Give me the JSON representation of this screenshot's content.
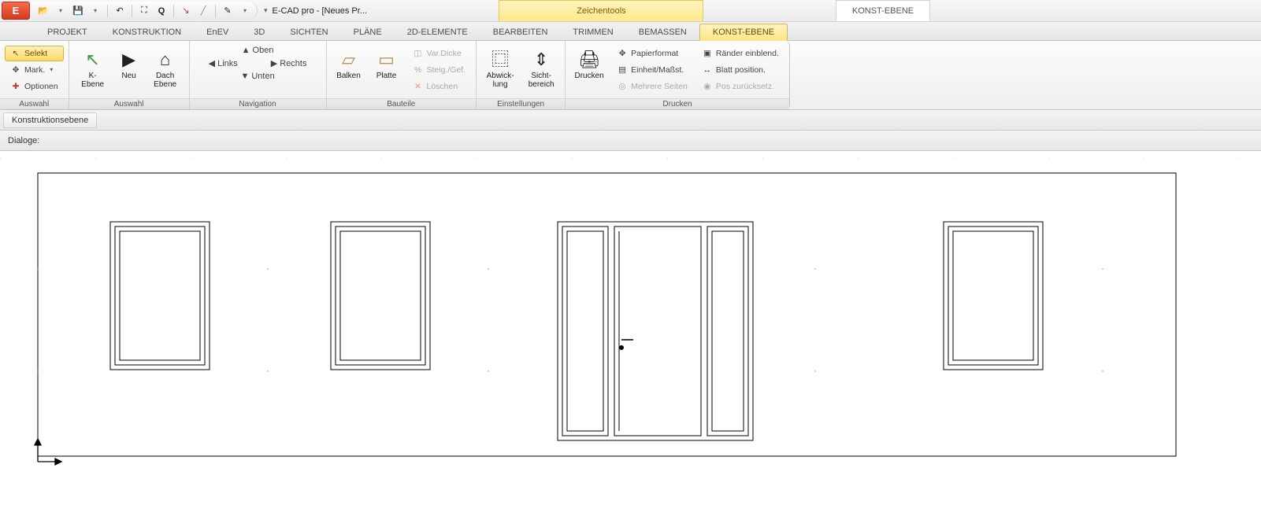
{
  "app": {
    "logo_letter": "E",
    "title": "E-CAD pro - [Neues Pr...",
    "context_tab": "Zeichentools",
    "context_tab2": "KONST-EBENE"
  },
  "qat": {
    "dropdown_glyph": "▾"
  },
  "tabs": [
    "PROJEKT",
    "KONSTRUKTION",
    "EnEV",
    "3D",
    "SICHTEN",
    "PLÄNE",
    "2D-ELEMENTE",
    "BEARBEITEN",
    "TRIMMEN",
    "BEMASSEN",
    "KONST-EBENE"
  ],
  "active_tab": "KONST-EBENE",
  "ribbon": {
    "auswahl1": {
      "label": "Auswahl",
      "selekt": "Selekt",
      "mark": "Mark.",
      "optionen": "Optionen"
    },
    "auswahl2": {
      "label": "Auswahl",
      "kebene_l1": "K-",
      "kebene_l2": "Ebene",
      "neu": "Neu",
      "dach_l1": "Dach",
      "dach_l2": "Ebene"
    },
    "navigation": {
      "label": "Navigation",
      "oben": "Oben",
      "links": "Links",
      "rechts": "Rechts",
      "unten": "Unten"
    },
    "bauteile": {
      "label": "Bauteile",
      "balken": "Balken",
      "platte": "Platte",
      "vardicke": "Var.Dicke",
      "steig": "Steig./Gef.",
      "loeschen": "Löschen"
    },
    "einstellungen": {
      "label": "Einstellungen",
      "abwick_l1": "Abwick-",
      "abwick_l2": "lung",
      "sicht_l1": "Sicht-",
      "sicht_l2": "bereich"
    },
    "drucken": {
      "label": "Drucken",
      "drucken": "Drucken",
      "papierformat": "Papierformat",
      "einheit": "Einheit/Maßst.",
      "mehrere": "Mehrere Seiten",
      "raender": "Ränder einblend.",
      "blattpos": "Blatt position.",
      "poszur": "Pos zurücksetz."
    }
  },
  "subbar": {
    "chip": "Konstruktionsebene"
  },
  "subbar2": {
    "label": "Dialoge:"
  }
}
